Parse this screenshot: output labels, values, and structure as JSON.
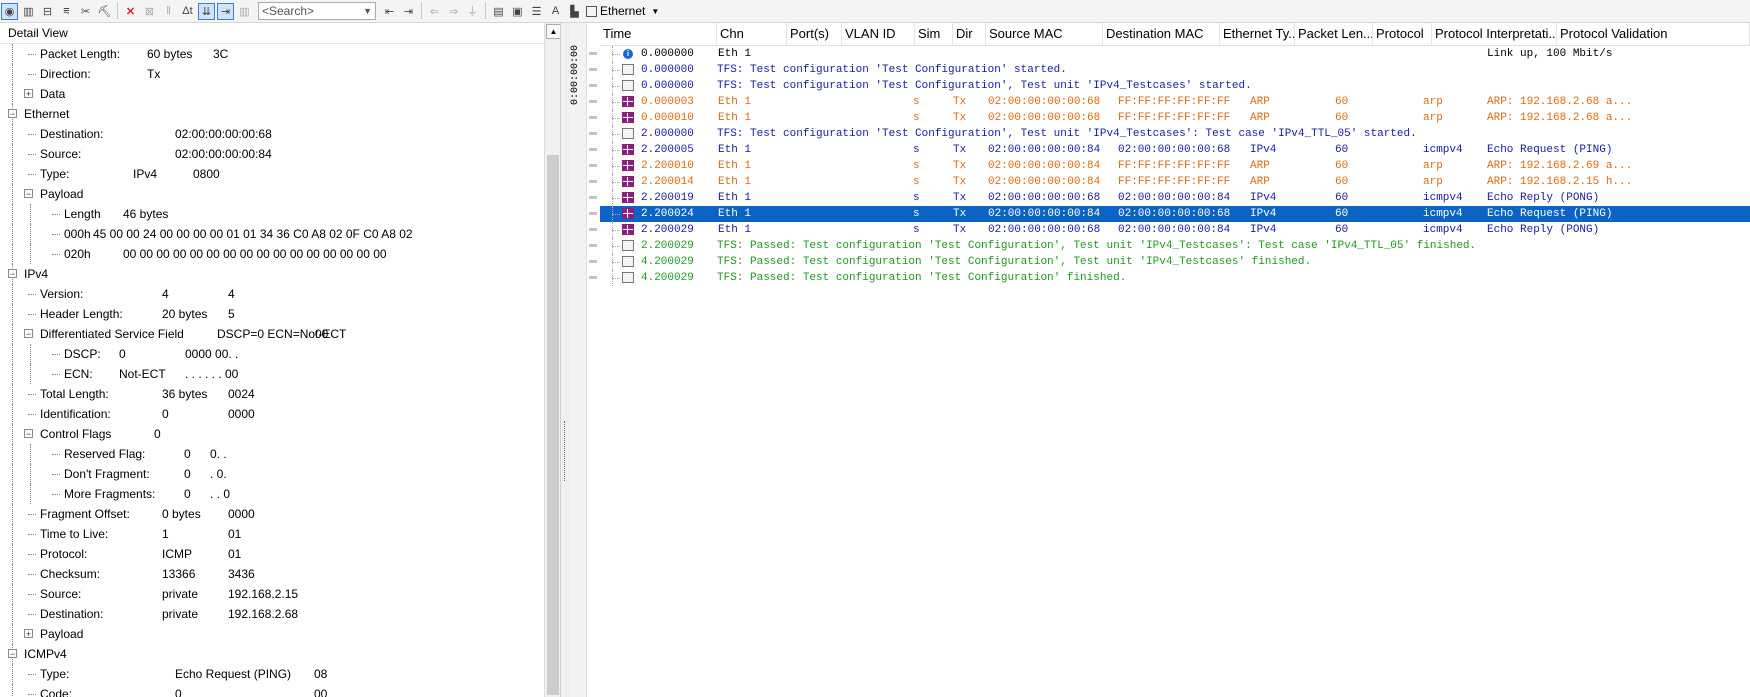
{
  "toolbar": {
    "search_placeholder": "<Search>",
    "bus_label": "Ethernet"
  },
  "detail": {
    "title": "Detail View",
    "rows": [
      {
        "name": "Packet Length:",
        "value": "60 bytes",
        "raw": "3C"
      },
      {
        "name": "Direction:",
        "value": "Tx",
        "raw": ""
      },
      {
        "name": "Data",
        "value": "",
        "raw": ""
      },
      {
        "name": "Ethernet",
        "value": "",
        "raw": ""
      },
      {
        "name": "Destination:",
        "value": "02:00:00:00:00:68",
        "raw": ""
      },
      {
        "name": "Source:",
        "value": "02:00:00:00:00:84",
        "raw": ""
      },
      {
        "name": "Type:",
        "value": "IPv4",
        "raw": "0800"
      },
      {
        "name": "Payload",
        "value": "",
        "raw": ""
      },
      {
        "name": "Length",
        "value": "46 bytes",
        "raw": ""
      },
      {
        "name": "000h",
        "value": "45  00  00  24  00  00  00  00  01  01  34  36  C0  A8  02  0F  C0  A8  02",
        "raw": ""
      },
      {
        "name": "020h",
        "value": "00  00  00  00  00  00  00  00  00  00  00  00  00  00  00  00",
        "raw": ""
      },
      {
        "name": "IPv4",
        "value": "",
        "raw": ""
      },
      {
        "name": "Version:",
        "value": "4",
        "raw": "4"
      },
      {
        "name": "Header Length:",
        "value": "20 bytes",
        "raw": "5"
      },
      {
        "name": "Differentiated Service Field",
        "value": "DSCP=0 ECN=Not-ECT",
        "raw": "00"
      },
      {
        "name": "DSCP:",
        "value": "0",
        "raw": "0000 00. ."
      },
      {
        "name": "ECN:",
        "value": "Not-ECT",
        "raw": ". . . . . . 00"
      },
      {
        "name": "Total Length:",
        "value": "36 bytes",
        "raw": "0024"
      },
      {
        "name": "Identification:",
        "value": "0",
        "raw": "0000"
      },
      {
        "name": "Control Flags",
        "value": "0",
        "raw": ""
      },
      {
        "name": "Reserved Flag:",
        "value": "0",
        "raw": "0. ."
      },
      {
        "name": "Don't Fragment:",
        "value": "0",
        "raw": ". 0."
      },
      {
        "name": "More Fragments:",
        "value": "0",
        "raw": ". . 0"
      },
      {
        "name": "Fragment Offset:",
        "value": "0 bytes",
        "raw": "0000"
      },
      {
        "name": "Time to Live:",
        "value": "1",
        "raw": "01"
      },
      {
        "name": "Protocol:",
        "value": "ICMP",
        "raw": "01"
      },
      {
        "name": "Checksum:",
        "value": "13366",
        "raw": "3436"
      },
      {
        "name": "Source:",
        "value": "private",
        "raw": "192.168.2.15"
      },
      {
        "name": "Destination:",
        "value": "private",
        "raw": "192.168.2.68"
      },
      {
        "name": "Payload",
        "value": "",
        "raw": ""
      },
      {
        "name": "ICMPv4",
        "value": "",
        "raw": ""
      },
      {
        "name": "Type:",
        "value": "Echo Request (PING)",
        "raw": "08"
      },
      {
        "name": "Code:",
        "value": "0",
        "raw": "00"
      }
    ]
  },
  "trace": {
    "axis_label": "0:00:00:00",
    "columns": [
      "Time",
      "Chn",
      "Port(s)",
      "VLAN ID",
      "Sim",
      "Dir",
      "Source MAC",
      "Destination MAC",
      "Ethernet Ty...",
      "Packet Len...",
      "Protocol",
      "Protocol Interpretati...",
      "Protocol Validation"
    ],
    "rows": [
      {
        "icon": "info",
        "color": "#000000",
        "time": "0.000000",
        "chn": "Eth 1",
        "sim": "",
        "dir": "",
        "src": "",
        "dst": "",
        "eth": "",
        "len": "",
        "proto": "",
        "interp": "Link up, 100 Mbit/s",
        "msg": ""
      },
      {
        "icon": "mail",
        "color": "#1a1aa8",
        "time": "0.000000",
        "msg": "TFS: Test configuration 'Test Configuration' started."
      },
      {
        "icon": "mail",
        "color": "#1a1aa8",
        "time": "0.000000",
        "msg": "TFS: Test configuration 'Test Configuration', Test unit 'IPv4_Testcases' started."
      },
      {
        "icon": "frame",
        "color": "#e06a10",
        "time": "0.000003",
        "chn": "Eth 1",
        "sim": "s",
        "dir": "Tx",
        "src": "02:00:00:00:00:68",
        "dst": "FF:FF:FF:FF:FF:FF",
        "eth": "ARP",
        "len": "60",
        "proto": "arp",
        "interp": "ARP: 192.168.2.68 a...",
        "msg": ""
      },
      {
        "icon": "frame",
        "color": "#e06a10",
        "time": "0.000010",
        "chn": "Eth 1",
        "sim": "s",
        "dir": "Tx",
        "src": "02:00:00:00:00:68",
        "dst": "FF:FF:FF:FF:FF:FF",
        "eth": "ARP",
        "len": "60",
        "proto": "arp",
        "interp": "ARP: 192.168.2.68 a...",
        "msg": ""
      },
      {
        "icon": "mail",
        "color": "#1a1aa8",
        "time": "2.000000",
        "msg": "TFS: Test configuration 'Test Configuration', Test unit 'IPv4_Testcases': Test case 'IPv4_TTL_05' started."
      },
      {
        "icon": "frame",
        "color": "#1a1aa8",
        "time": "2.200005",
        "chn": "Eth 1",
        "sim": "s",
        "dir": "Tx",
        "src": "02:00:00:00:00:84",
        "dst": "02:00:00:00:00:68",
        "eth": "IPv4",
        "len": "60",
        "proto": "icmpv4",
        "interp": "Echo Request (PING)",
        "msg": ""
      },
      {
        "icon": "frame",
        "color": "#e06a10",
        "time": "2.200010",
        "chn": "Eth 1",
        "sim": "s",
        "dir": "Tx",
        "src": "02:00:00:00:00:84",
        "dst": "FF:FF:FF:FF:FF:FF",
        "eth": "ARP",
        "len": "60",
        "proto": "arp",
        "interp": "ARP: 192.168.2.69 a...",
        "msg": ""
      },
      {
        "icon": "frame",
        "color": "#e06a10",
        "time": "2.200014",
        "chn": "Eth 1",
        "sim": "s",
        "dir": "Tx",
        "src": "02:00:00:00:00:84",
        "dst": "FF:FF:FF:FF:FF:FF",
        "eth": "ARP",
        "len": "60",
        "proto": "arp",
        "interp": "ARP: 192.168.2.15 h...",
        "msg": ""
      },
      {
        "icon": "frame",
        "color": "#1a1aa8",
        "time": "2.200019",
        "chn": "Eth 1",
        "sim": "s",
        "dir": "Tx",
        "src": "02:00:00:00:00:68",
        "dst": "02:00:00:00:00:84",
        "eth": "IPv4",
        "len": "60",
        "proto": "icmpv4",
        "interp": "Echo Reply (PONG)",
        "msg": ""
      },
      {
        "icon": "frame",
        "color": "#ffffff",
        "selected": true,
        "time": "2.200024",
        "chn": "Eth 1",
        "sim": "s",
        "dir": "Tx",
        "src": "02:00:00:00:00:84",
        "dst": "02:00:00:00:00:68",
        "eth": "IPv4",
        "len": "60",
        "proto": "icmpv4",
        "interp": "Echo Request (PING)",
        "msg": ""
      },
      {
        "icon": "frame",
        "color": "#1a1aa8",
        "time": "2.200029",
        "chn": "Eth 1",
        "sim": "s",
        "dir": "Tx",
        "src": "02:00:00:00:00:68",
        "dst": "02:00:00:00:00:84",
        "eth": "IPv4",
        "len": "60",
        "proto": "icmpv4",
        "interp": "Echo Reply (PONG)",
        "msg": ""
      },
      {
        "icon": "mail",
        "color": "#1f9a1f",
        "time": "2.200029",
        "msg": "TFS: Passed: Test configuration 'Test Configuration', Test unit 'IPv4_Testcases': Test case 'IPv4_TTL_05' finished."
      },
      {
        "icon": "mail",
        "color": "#1f9a1f",
        "time": "4.200029",
        "msg": "TFS: Passed: Test configuration 'Test Configuration', Test unit 'IPv4_Testcases' finished."
      },
      {
        "icon": "mail",
        "color": "#1f9a1f",
        "time": "4.200029",
        "msg": "TFS: Passed: Test configuration 'Test Configuration' finished."
      }
    ]
  }
}
